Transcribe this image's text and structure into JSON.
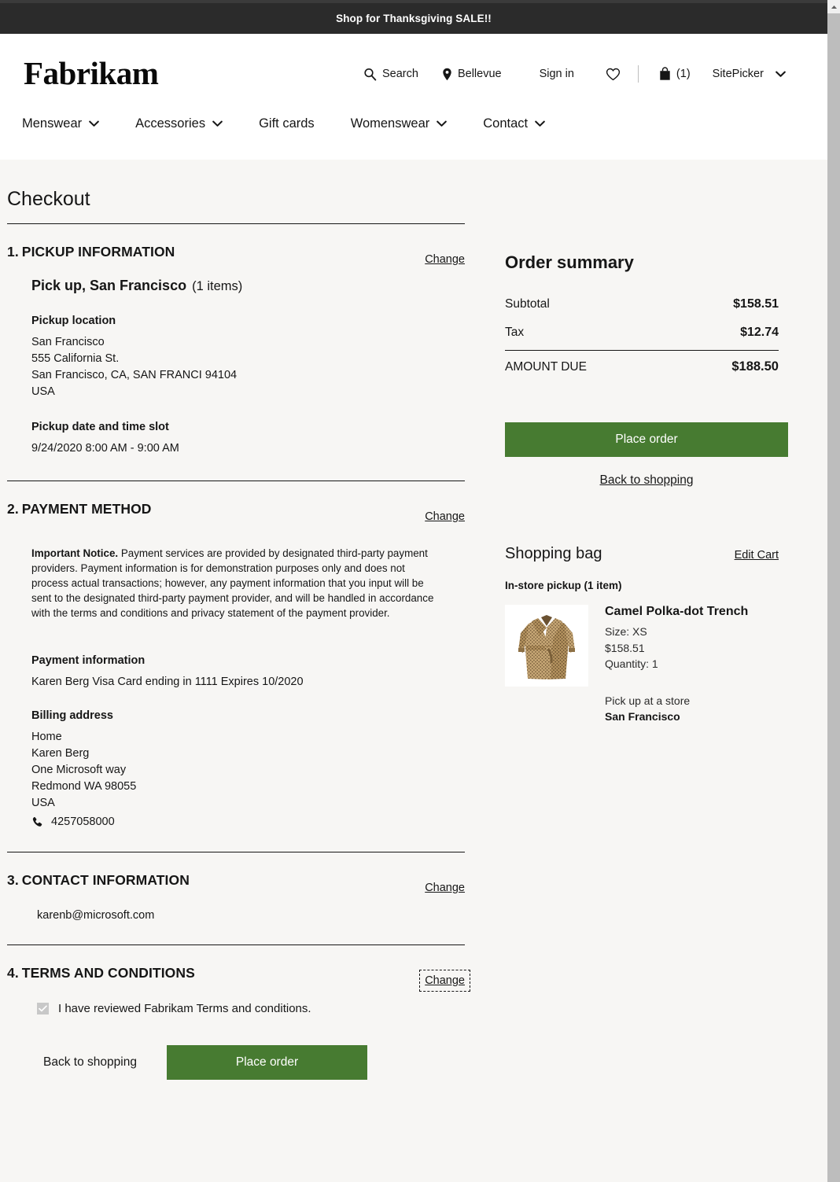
{
  "promo": {
    "text": "Shop for Thanksgiving SALE!!"
  },
  "header": {
    "logo": "Fabrikam",
    "utils": {
      "search": "Search",
      "location": "Bellevue",
      "signin": "Sign in",
      "bag_count": "(1)",
      "sitepicker": "SitePicker"
    },
    "nav": [
      {
        "label": "Menswear",
        "has_chevron": true
      },
      {
        "label": "Accessories",
        "has_chevron": true
      },
      {
        "label": "Gift cards",
        "has_chevron": false
      },
      {
        "label": "Womenswear",
        "has_chevron": true
      },
      {
        "label": "Contact",
        "has_chevron": true
      }
    ]
  },
  "page_title": "Checkout",
  "sections": {
    "pickup": {
      "number": "1.",
      "title": "PICKUP INFORMATION",
      "change": "Change",
      "heading": "Pick up, San Francisco",
      "items_count": "(1 items)",
      "location_label": "Pickup location",
      "location_lines": [
        "San Francisco",
        "555 California St.",
        "San Francisco, CA, SAN FRANCI 94104",
        "USA"
      ],
      "datetime_label": "Pickup date and time slot",
      "datetime_value": "9/24/2020 8:00 AM - 9:00 AM"
    },
    "payment": {
      "number": "2.",
      "title": "PAYMENT METHOD",
      "change": "Change",
      "notice_bold": "Important Notice.",
      "notice_text": " Payment services are provided by designated third-party payment providers.  Payment information is for demonstration purposes only and does not process actual transactions; however, any payment information that you input will be sent to the designated third-party payment provider, and will be handled in accordance with the terms and conditions and privacy statement of the payment provider.",
      "info_label": "Payment information",
      "info_value": "Karen Berg   Visa   Card ending in 1111   Expires 10/2020",
      "billing_label": "Billing address",
      "billing_lines": [
        "Home",
        "Karen Berg",
        "One Microsoft way",
        "Redmond WA   98055",
        "USA"
      ],
      "phone": "4257058000"
    },
    "contact": {
      "number": "3.",
      "title": "CONTACT INFORMATION",
      "change": "Change",
      "email": "karenb@microsoft.com"
    },
    "terms": {
      "number": "4.",
      "title": "TERMS AND CONDITIONS",
      "change": "Change",
      "checkbox_label": "I have reviewed Fabrikam Terms and conditions.",
      "checked": true
    }
  },
  "bottom_actions": {
    "back": "Back to shopping",
    "place_order": "Place order"
  },
  "order_summary": {
    "title": "Order summary",
    "rows": [
      {
        "label": "Subtotal",
        "value": "$158.51"
      },
      {
        "label": "Tax",
        "value": "$12.74"
      }
    ],
    "total_label": "AMOUNT DUE",
    "total_value": "$188.50",
    "place_order": "Place order",
    "back_to_shopping": "Back to shopping"
  },
  "shopping_bag": {
    "title": "Shopping bag",
    "edit_cart": "Edit Cart",
    "group_label": "In-store pickup (1 item)",
    "item": {
      "name": "Camel Polka-dot Trench",
      "size": "Size: XS",
      "price": "$158.51",
      "quantity": "Quantity: 1",
      "pickup_label": "Pick up at a store",
      "store": "San Francisco"
    }
  },
  "colors": {
    "accent_green": "#477b31",
    "banner_dark": "#2b2b2b",
    "page_bg": "#f7f6f4"
  }
}
